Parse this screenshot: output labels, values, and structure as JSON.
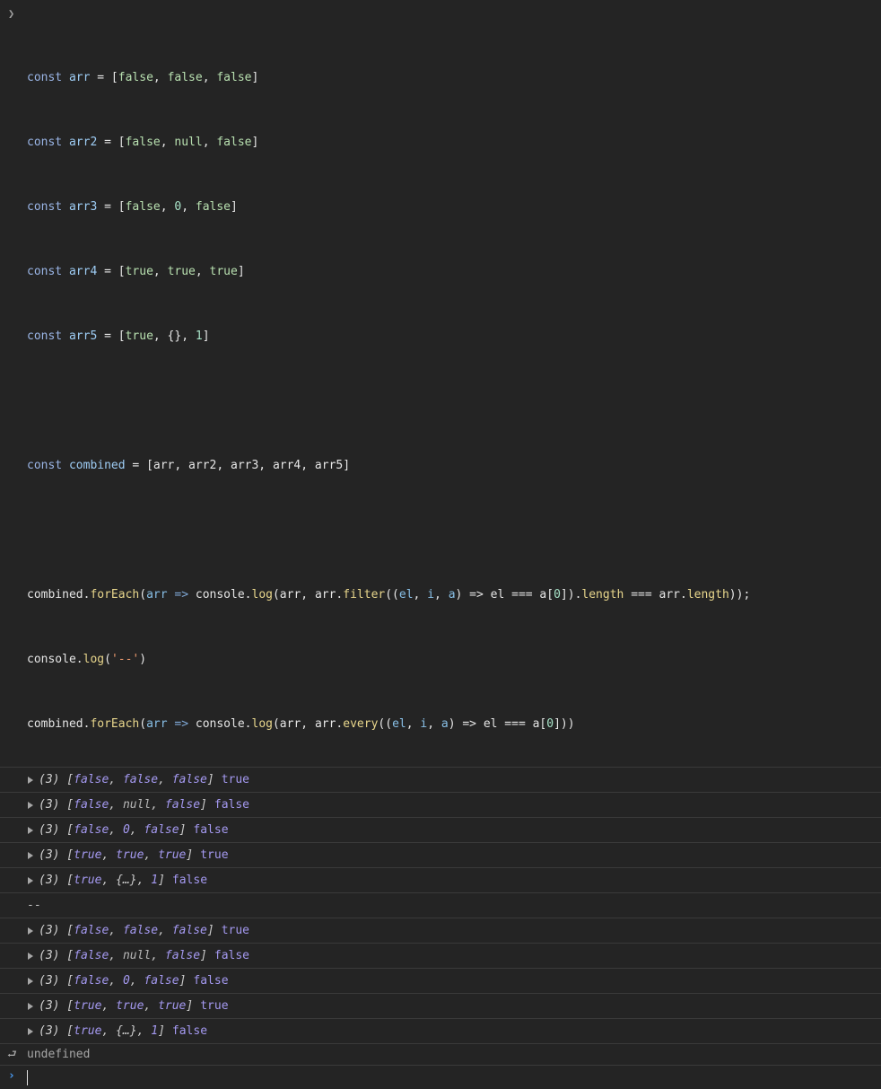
{
  "input": {
    "prompt_icon": "chevron-right-icon",
    "lines": [
      [
        "const",
        " ",
        "arr",
        " = [",
        "false",
        ", ",
        "false",
        ", ",
        "false",
        "]"
      ],
      [
        "const",
        " ",
        "arr2",
        " = [",
        "false",
        ", ",
        "null",
        ", ",
        "false",
        "]"
      ],
      [
        "const",
        " ",
        "arr3",
        " = [",
        "false",
        ", ",
        "0",
        ", ",
        "false",
        "]"
      ],
      [
        "const",
        " ",
        "arr4",
        " = [",
        "true",
        ", ",
        "true",
        ", ",
        "true",
        "]"
      ],
      [
        "const",
        " ",
        "arr5",
        " = [",
        "true",
        ", {}, ",
        "1",
        "]"
      ]
    ],
    "combined_line": {
      "kw": "const",
      "name": "combined",
      "rest": " = [arr, arr2, arr3, arr4, arr5]"
    },
    "line_a": {
      "obj": "combined.",
      "method": "forEach",
      "p1": "(",
      "arg": "arr",
      "arrow": " => ",
      "call": "console.",
      "log": "log",
      "p2": "(arr, arr.",
      "filter": "filter",
      "p3": "((",
      "el": "el",
      "c1": ", ",
      "i": "i",
      "c2": ", ",
      "a": "a",
      "p4": ") => el === a[",
      "zero": "0",
      "p5": "]).",
      "length1": "length",
      "p6": " === arr.",
      "length2": "length",
      "p7": "));"
    },
    "line_b": {
      "call": "console.",
      "log": "log",
      "p1": "(",
      "str": "'--'",
      "p2": ")"
    },
    "line_c": {
      "obj": "combined.",
      "method": "forEach",
      "p1": "(",
      "arg": "arr",
      "arrow": " => ",
      "call": "console.",
      "log": "log",
      "p2": "(arr, arr.",
      "every": "every",
      "p3": "((",
      "el": "el",
      "c1": ", ",
      "i": "i",
      "c2": ", ",
      "a": "a",
      "p4": ") => el === a[",
      "zero": "0",
      "p5": "]))"
    }
  },
  "outputs_first": [
    {
      "count": "(3)",
      "items": [
        "false",
        "false",
        "false"
      ],
      "result": "true"
    },
    {
      "count": "(3)",
      "items": [
        "false",
        "null",
        "false"
      ],
      "result": "false"
    },
    {
      "count": "(3)",
      "items": [
        "false",
        "0",
        "false"
      ],
      "result": "false"
    },
    {
      "count": "(3)",
      "items": [
        "true",
        "true",
        "true"
      ],
      "result": "true"
    },
    {
      "count": "(3)",
      "items": [
        "true",
        "{…}",
        "1"
      ],
      "result": "false"
    }
  ],
  "separator": "--",
  "outputs_second": [
    {
      "count": "(3)",
      "items": [
        "false",
        "false",
        "false"
      ],
      "result": "true"
    },
    {
      "count": "(3)",
      "items": [
        "false",
        "null",
        "false"
      ],
      "result": "false"
    },
    {
      "count": "(3)",
      "items": [
        "false",
        "0",
        "false"
      ],
      "result": "false"
    },
    {
      "count": "(3)",
      "items": [
        "true",
        "true",
        "true"
      ],
      "result": "true"
    },
    {
      "count": "(3)",
      "items": [
        "true",
        "{…}",
        "1"
      ],
      "result": "false"
    }
  ],
  "return_value": "undefined",
  "colors": {
    "background": "#242424",
    "boolean": "#a499f0",
    "prompt_blue": "#4a9cf5"
  }
}
